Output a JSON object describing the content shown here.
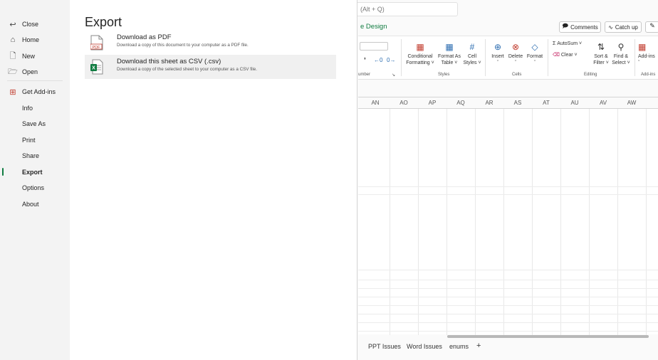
{
  "nav": {
    "items": [
      {
        "label": "Close",
        "icon": "back-arrow-icon"
      },
      {
        "label": "Home",
        "icon": "home-icon"
      },
      {
        "label": "New",
        "icon": "new-doc-icon"
      },
      {
        "label": "Open",
        "icon": "folder-icon"
      },
      {
        "label": "Get Add-ins",
        "icon": "addins-icon"
      },
      {
        "label": "Info"
      },
      {
        "label": "Save As"
      },
      {
        "label": "Print"
      },
      {
        "label": "Share"
      },
      {
        "label": "Export",
        "selected": true
      },
      {
        "label": "Options"
      },
      {
        "label": "About"
      }
    ]
  },
  "export": {
    "title": "Export",
    "options": [
      {
        "title": "Download as PDF",
        "description": "Download a copy of this document to your computer as a PDF file.",
        "icon": "pdf-file-icon"
      },
      {
        "title": "Download this sheet as CSV (.csv)",
        "description": "Download a copy of the selected sheet to your computer as a CSV file.",
        "icon": "excel-csv-icon"
      }
    ]
  },
  "excel": {
    "search_placeholder": "(Alt + Q)",
    "tab_design": "e Design",
    "comments_label": "Comments",
    "catchup_label": "Catch up",
    "ribbon": {
      "conditional": "Conditional",
      "formatting": "Formatting ˅",
      "format_as": "Format As",
      "table": "Table ˅",
      "cell": "Cell",
      "styles_btn": "Styles ˅",
      "insert": "Insert",
      "delete": "Delete",
      "format": "Format",
      "autosum": "AutoSum ˅",
      "clear": "Clear ˅",
      "sort": "Sort &",
      "filter": "Filter ˅",
      "find": "Find &",
      "select": "Select ˅",
      "addins": "Add-ins",
      "group_number": "umber",
      "group_styles": "Styles",
      "group_cells": "Cells",
      "group_editing": "Editing",
      "group_addins": "Add-ins"
    },
    "columns": [
      "AN",
      "AO",
      "AP",
      "AQ",
      "AR",
      "AS",
      "AT",
      "AU",
      "AV",
      "AW"
    ],
    "sheet_tabs": [
      "PPT Issues",
      "Word Issues",
      "enums"
    ],
    "add_sheet": "+"
  }
}
